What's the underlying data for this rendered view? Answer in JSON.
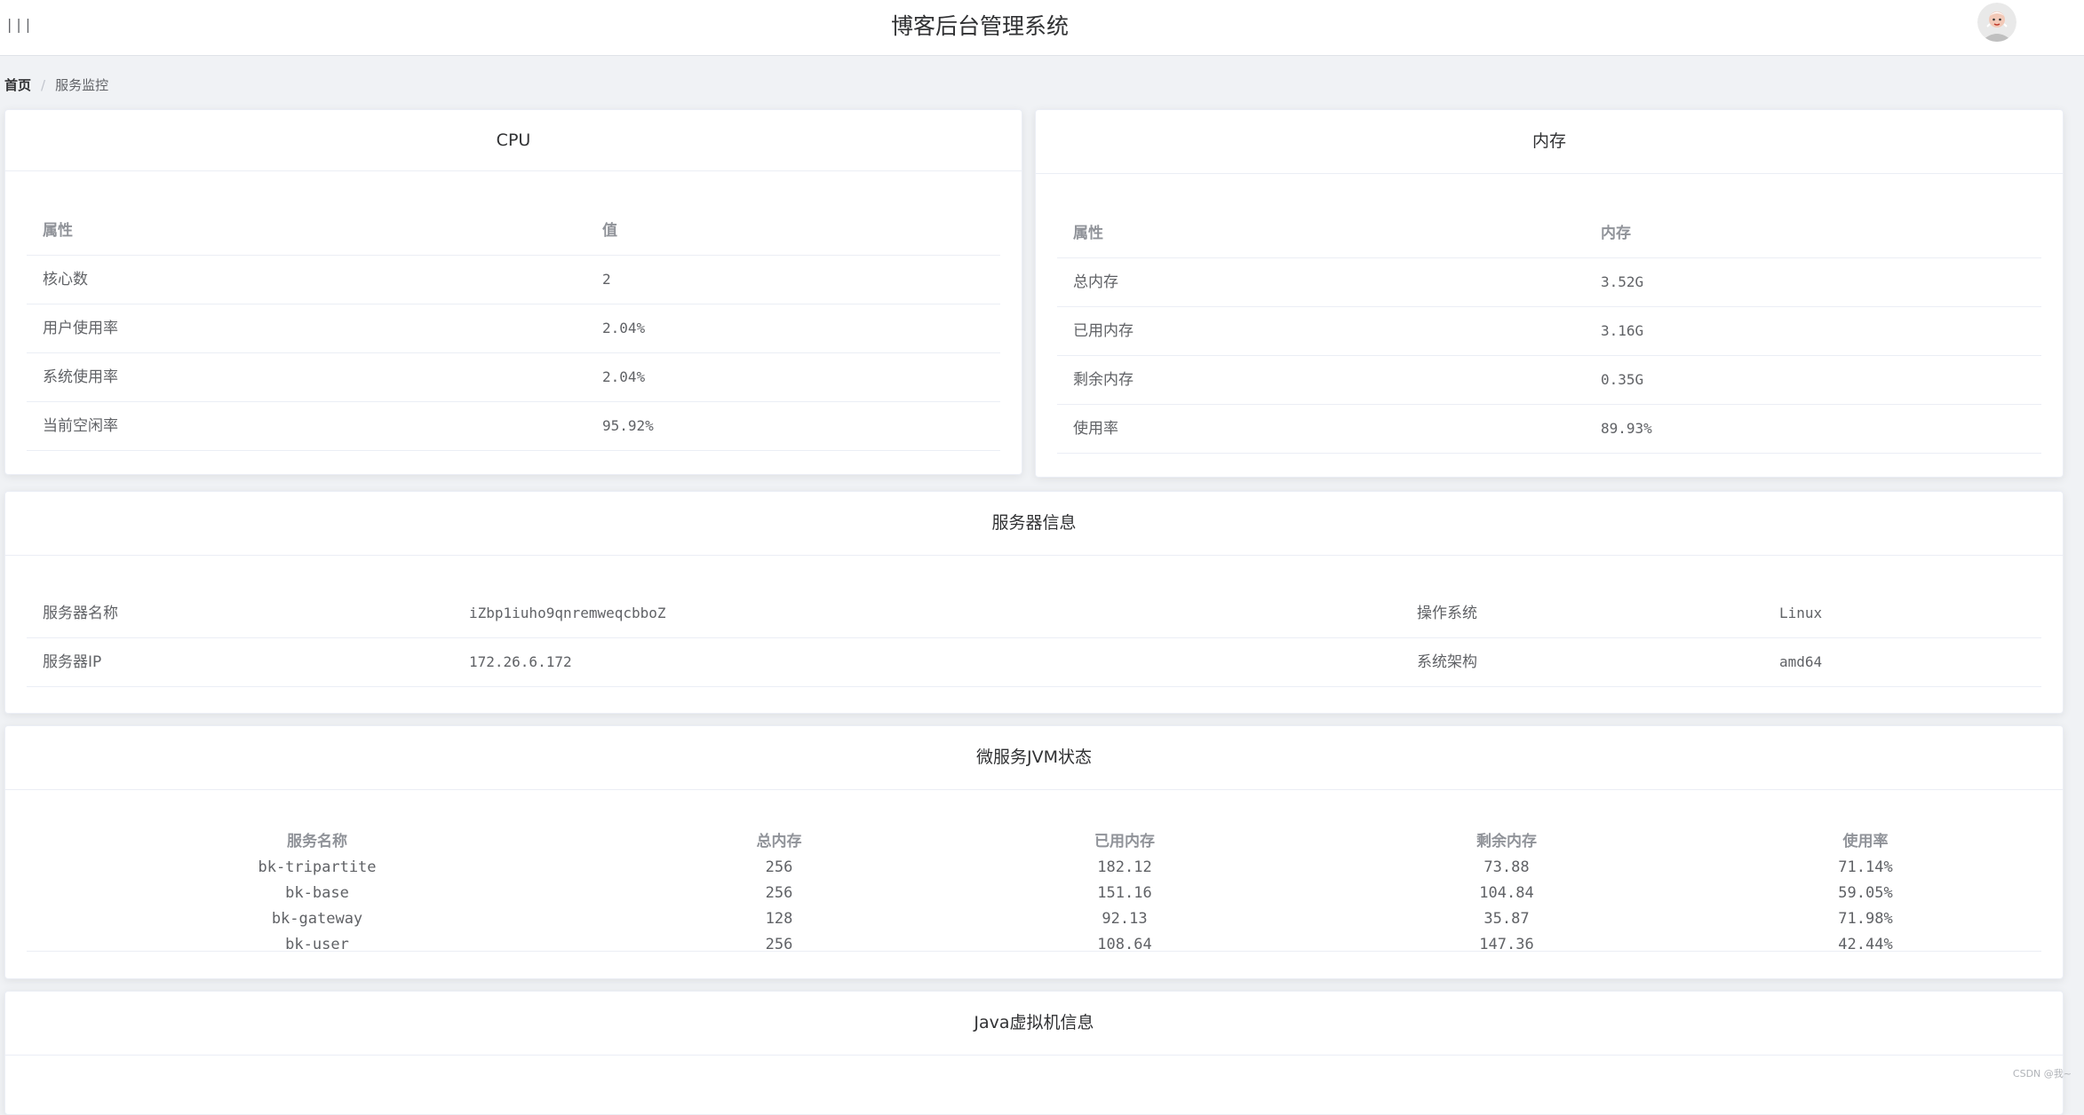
{
  "header": {
    "menu_icon": "hamburger-icon",
    "title": "博客后台管理系统",
    "avatar_icon": "user-avatar-icon"
  },
  "breadcrumb": {
    "home": "首页",
    "separator": "/",
    "current": "服务监控"
  },
  "cpu": {
    "title": "CPU",
    "col_attr": "属性",
    "col_value": "值",
    "rows": [
      {
        "label": "核心数",
        "value": "2"
      },
      {
        "label": "用户使用率",
        "value": "2.04%"
      },
      {
        "label": "系统使用率",
        "value": "2.04%"
      },
      {
        "label": "当前空闲率",
        "value": "95.92%"
      }
    ]
  },
  "memory": {
    "title": "内存",
    "col_attr": "属性",
    "col_value": "内存",
    "rows": [
      {
        "label": "总内存",
        "value": "3.52G"
      },
      {
        "label": "已用内存",
        "value": "3.16G"
      },
      {
        "label": "剩余内存",
        "value": "0.35G"
      },
      {
        "label": "使用率",
        "value": "89.93%"
      }
    ]
  },
  "server": {
    "title": "服务器信息",
    "rows": [
      {
        "label1": "服务器名称",
        "value1": "iZbp1iuho9qnremweqcbboZ",
        "label2": "操作系统",
        "value2": "Linux"
      },
      {
        "label1": "服务器IP",
        "value1": "172.26.6.172",
        "label2": "系统架构",
        "value2": "amd64"
      }
    ]
  },
  "jvm": {
    "title": "微服务JVM状态",
    "headers": [
      "服务名称",
      "总内存",
      "已用内存",
      "剩余内存",
      "使用率"
    ],
    "rows": [
      [
        "bk-tripartite",
        "256",
        "182.12",
        "73.88",
        "71.14%"
      ],
      [
        "bk-base",
        "256",
        "151.16",
        "104.84",
        "59.05%"
      ],
      [
        "bk-gateway",
        "128",
        "92.13",
        "35.87",
        "71.98%"
      ],
      [
        "bk-user",
        "256",
        "108.64",
        "147.36",
        "42.44%"
      ]
    ]
  },
  "java_vm": {
    "title": "Java虚拟机信息"
  },
  "watermark": "CSDN @我~"
}
